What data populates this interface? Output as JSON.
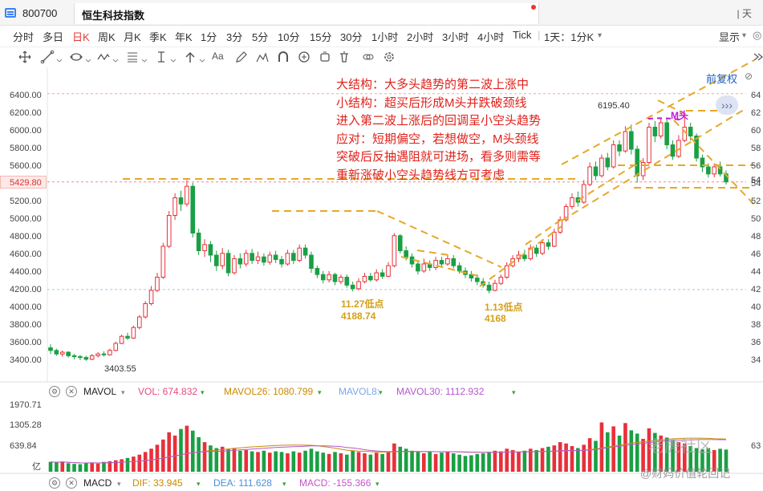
{
  "window": {
    "code": "800700",
    "name": "恒生科技指数",
    "controls": "| 天"
  },
  "periods": {
    "items": [
      "分时",
      "多日",
      "日K",
      "周K",
      "月K",
      "季K",
      "年K",
      "1分",
      "3分",
      "5分",
      "10分",
      "15分",
      "30分",
      "1小时",
      "2小时",
      "3小时",
      "4小时",
      "Tick"
    ],
    "active": "日K",
    "multi": "1天：1分K",
    "display": "显示"
  },
  "toolbar": {
    "tools": [
      "crosshair-icon",
      "line-icon",
      "shape-icon",
      "wave-icon",
      "fib-icon",
      "arrow-icon",
      "text-icon",
      "magnet-icon",
      "lock-icon",
      "trash-icon",
      "eye-icon",
      "settings-icon"
    ],
    "text_tool": "Aa"
  },
  "chart": {
    "fuquan_link": "前复权",
    "y_ticks": [
      "6400.00",
      "6200.00",
      "6000.00",
      "5800.00",
      "5600.00",
      "5400.00",
      "5200.00",
      "5000.00",
      "4800.00",
      "4600.00",
      "4400.00",
      "4200.00",
      "4000.00",
      "3800.00",
      "3600.00",
      "3400.00"
    ],
    "y_ticks_right": [
      "64",
      "62",
      "60",
      "58",
      "56",
      "54",
      "52",
      "50",
      "48",
      "46",
      "44",
      "42",
      "40",
      "38",
      "36",
      "34"
    ],
    "current_price": "5429.80",
    "current_price_right": "54",
    "high_label": "6195.40",
    "low_label": "3403.55",
    "m_top_label": "M头",
    "low1_date": "11.27低点",
    "low1_value": "4188.74",
    "low2_date": "1.13低点",
    "low2_value": "4168",
    "annotation": [
      "大结构：大多头趋势的第二波上涨中",
      "小结构：超买后形成M头并跌破颈线",
      "进入第二波上涨后的回调呈小空头趋势",
      "应对：短期偏空，若想做空，M头颈线",
      "突破后反抽遇阻就可进场，看多则需等",
      "重新涨破小空头趋势线方可考虑"
    ],
    "more_button": "›››",
    "colors": {
      "up": "#e8303a",
      "down": "#19a044",
      "annotation": "#e0221b",
      "trendline": "#e6a82a",
      "background": "#ffffff"
    }
  },
  "mavol": {
    "name": "MAVOL",
    "vol": "VOL: 674.832",
    "mavol26": "MAVOL26: 1080.799",
    "mavol8": "MAVOL8:",
    "mavol30": "MAVOL30: 1112.932",
    "ticks": [
      "1970.71",
      "1305.28",
      "639.84",
      "亿"
    ],
    "ticks_right": [
      "",
      "",
      "63",
      ""
    ]
  },
  "macd": {
    "name": "MACD",
    "dif": "DIF: 33.945",
    "dea": "DEA: 111.628",
    "macd": "MACD: -155.366"
  },
  "watermarks": {
    "community": "老虎社区",
    "author": "@财妈价值轮回记"
  }
}
